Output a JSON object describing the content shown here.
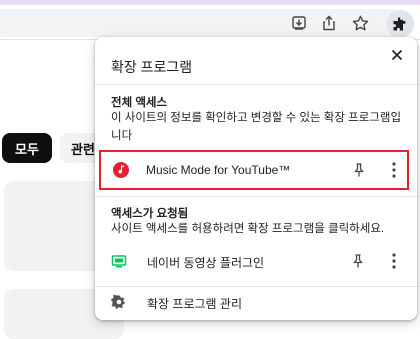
{
  "popup": {
    "title": "확장 프로그램",
    "section_full_access": {
      "heading": "전체 액세스",
      "description_line1": "이 사이트의 정보를 확인하고 변경할 수 있는 확장 프로그램입",
      "description_line2": "니다",
      "extensions": [
        {
          "name": "Music Mode for YouTube™",
          "icon": "music-note-icon",
          "icon_color": "#e3232c"
        }
      ]
    },
    "section_requested": {
      "heading": "액세스가 요청됨",
      "description": "사이트 액세스를 허용하려면 확장 프로그램을 클릭하세요.",
      "extensions": [
        {
          "name": "네이버 동영상 플러그인",
          "icon": "video-plugin-icon",
          "icon_color": "#03c75a"
        }
      ]
    },
    "manage_label": "확장 프로그램 관리"
  },
  "page": {
    "chips": [
      "모두",
      "관련"
    ]
  },
  "colors": {
    "highlight_border": "#e3232c",
    "accent_naver": "#03c75a",
    "tab_strip": "#e8dcf5"
  }
}
